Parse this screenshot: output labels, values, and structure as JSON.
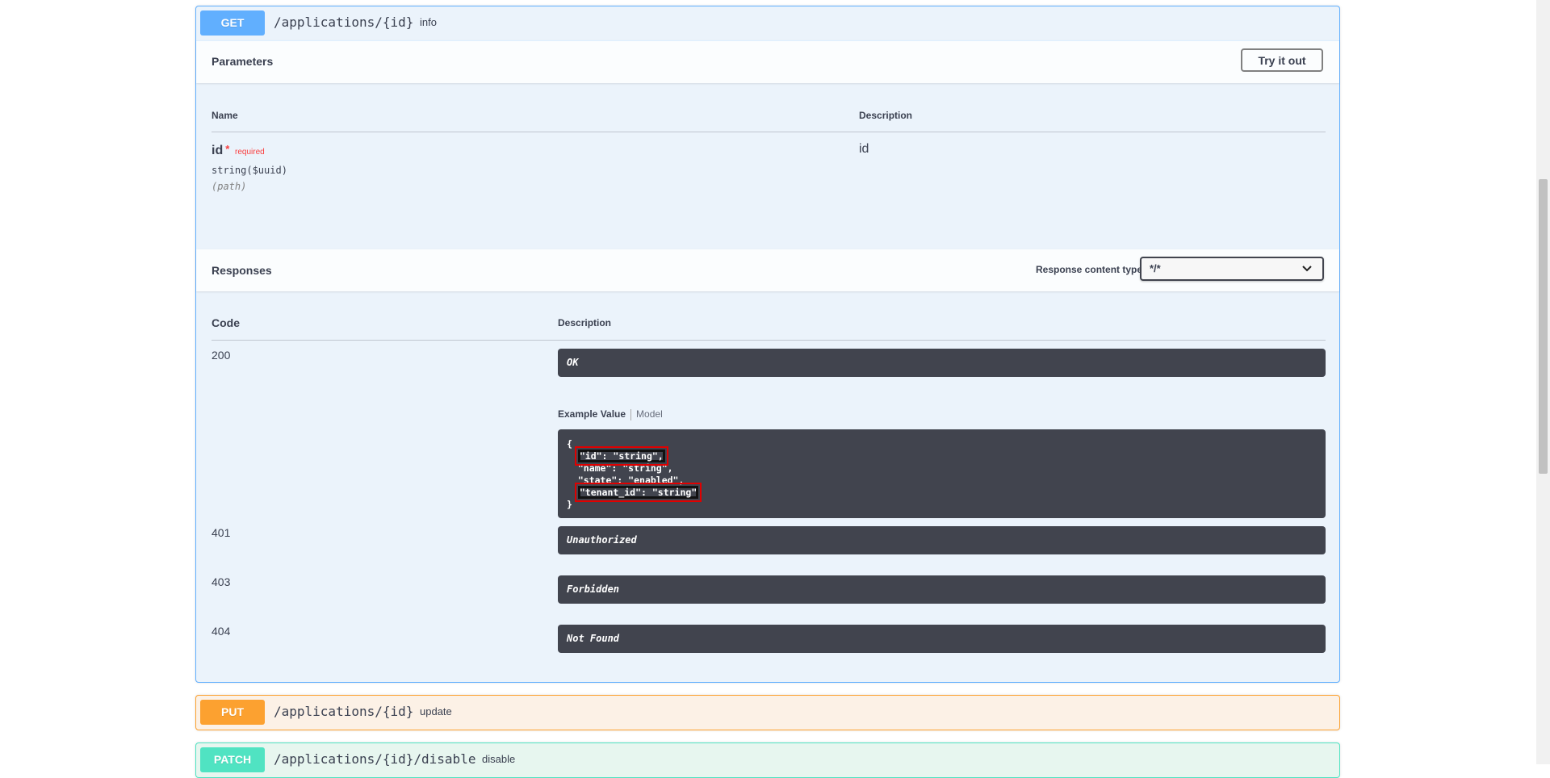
{
  "get_op": {
    "method": "GET",
    "path": "/applications/{id}",
    "summary": "info",
    "parameters_title": "Parameters",
    "try_button": "Try it out",
    "param_headers": {
      "name": "Name",
      "description": "Description"
    },
    "param": {
      "name": "id",
      "star": "*",
      "required_text": "required",
      "type": "string($uuid)",
      "in": "(path)",
      "description": "id"
    },
    "responses_title": "Responses",
    "content_type_label": "Response content type",
    "content_type_value": "*/*",
    "response_headers": {
      "code": "Code",
      "description": "Description"
    },
    "responses": [
      {
        "code": "200",
        "description": "OK"
      },
      {
        "code": "401",
        "description": "Unauthorized"
      },
      {
        "code": "403",
        "description": "Forbidden"
      },
      {
        "code": "404",
        "description": "Not Found"
      }
    ],
    "example_tabs": {
      "example": "Example Value",
      "model": "Model"
    },
    "example_json": {
      "open": "{",
      "line_id": "\"id\": \"string\",",
      "line_name": "\"name\": \"string\",",
      "line_state": "\"state\": \"enabled\",",
      "line_tenant": "\"tenant_id\": \"string\"",
      "close": "}"
    }
  },
  "put_op": {
    "method": "PUT",
    "path": "/applications/{id}",
    "summary": "update"
  },
  "patch_op": {
    "method": "PATCH",
    "path": "/applications/{id}/disable",
    "summary": "disable"
  },
  "colors": {
    "get": "#61affe",
    "put": "#fca130",
    "patch": "#50e3c2",
    "dark": "#41444e",
    "required": "#f93e3e",
    "highlight": "#e00000"
  }
}
